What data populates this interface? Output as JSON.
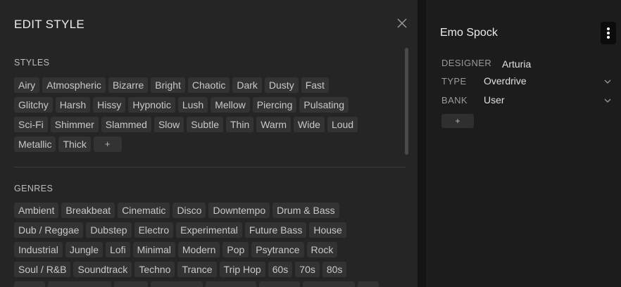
{
  "edit_style": {
    "title": "EDIT STYLE",
    "styles_label": "STYLES",
    "styles_rows": [
      [
        "Airy",
        "Atmospheric",
        "Bizarre",
        "Bright",
        "Chaotic",
        "Dark",
        "Dusty",
        "Fast"
      ],
      [
        "Glitchy",
        "Harsh",
        "Hissy",
        "Hypnotic",
        "Lush",
        "Mellow",
        "Piercing",
        "Pulsating"
      ],
      [
        "Sci-Fi",
        "Shimmer",
        "Slammed",
        "Slow",
        "Subtle",
        "Thin",
        "Warm",
        "Wide",
        "Loud"
      ],
      [
        "Metallic",
        "Thick"
      ]
    ],
    "add_label": "+",
    "genres_label": "GENRES",
    "genres_rows": [
      [
        "Ambient",
        "Breakbeat",
        "Cinematic",
        "Disco",
        "Downtempo",
        "Drum & Bass"
      ],
      [
        "Dub / Reggae",
        "Dubstep",
        "Electro",
        "Experimental",
        "Future Bass",
        "House"
      ],
      [
        "Industrial",
        "Jungle",
        "Lofi",
        "Minimal",
        "Modern",
        "Pop",
        "Psytrance",
        "Rock"
      ],
      [
        "Soul / R&B",
        "Soundtrack",
        "Techno",
        "Trance",
        "Trip Hop",
        "60s",
        "70s",
        "80s"
      ]
    ]
  },
  "preset": {
    "name": "Emo Spock",
    "designer_label": "DESIGNER",
    "designer_value": "Arturia",
    "type_label": "TYPE",
    "type_value": "Overdrive",
    "bank_label": "BANK",
    "bank_value": "User",
    "add_label": "+"
  }
}
